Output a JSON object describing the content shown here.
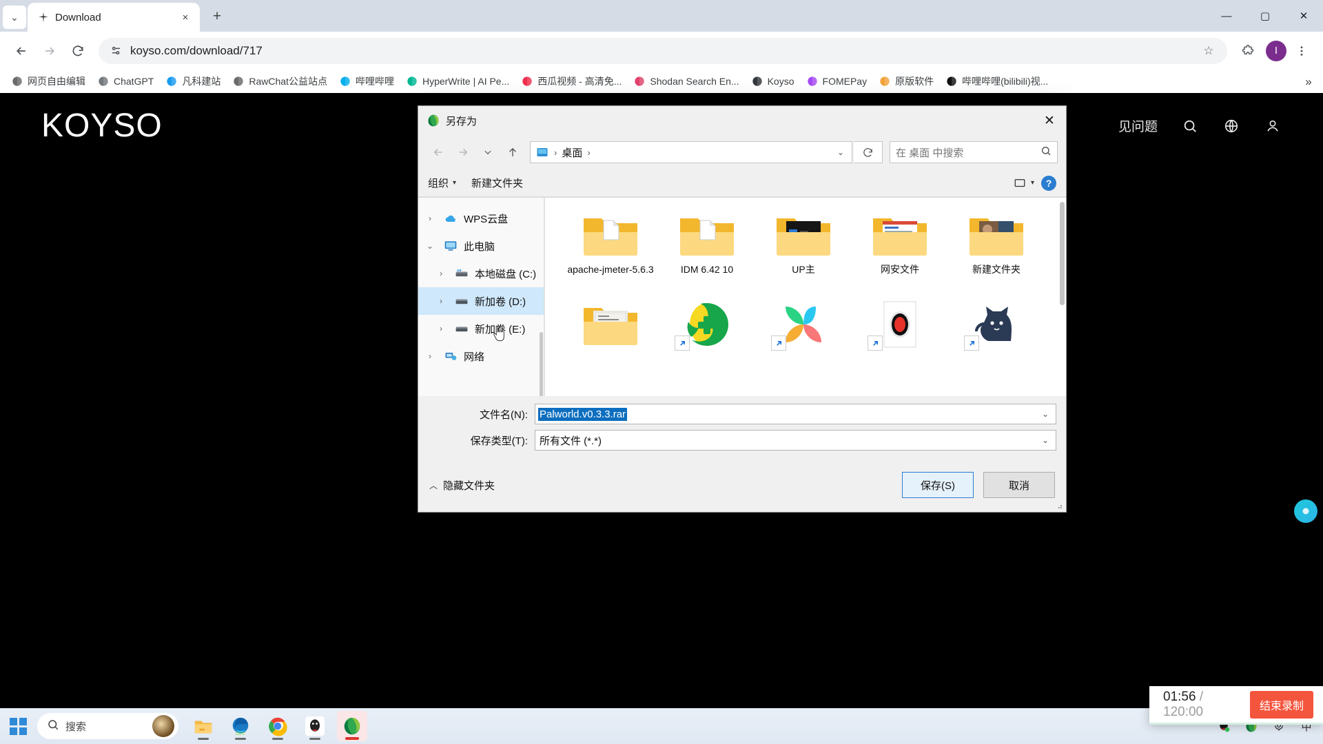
{
  "browser": {
    "tab": {
      "title": "Download",
      "favicon": "sparkle-icon",
      "close": "×"
    },
    "newtab_label": "+",
    "tablist_caret": "⌄",
    "window_controls": {
      "minimize": "—",
      "maximize": "▢",
      "close": "✕"
    },
    "toolbar": {
      "back": "←",
      "forward": "→",
      "reload": "⟳",
      "url": "koyso.com/download/717",
      "site_info_icon": "page-info-icon",
      "bookmark_star": "☆",
      "extensions": "puzzle-icon",
      "profile_initial": "I",
      "menu": "⋮"
    },
    "bookmarks": [
      {
        "label": "网页自由编辑",
        "icon": "globe-icon",
        "color": "#6a6a6a"
      },
      {
        "label": "ChatGPT",
        "icon": "openai-icon",
        "color": "#74797e"
      },
      {
        "label": "凡科建站",
        "icon": "fanke-icon",
        "color": "#1a9cf0"
      },
      {
        "label": "RawChat公益站点",
        "icon": "globe-icon",
        "color": "#6a6a6a"
      },
      {
        "label": "哔哩哔哩",
        "icon": "bilibili-icon",
        "color": "#00aeec"
      },
      {
        "label": "HyperWrite | AI Pe...",
        "icon": "hyperwrite-icon",
        "color": "#00b894"
      },
      {
        "label": "西瓜视频 - 高清免...",
        "icon": "xigua-icon",
        "color": "#ef2e4d"
      },
      {
        "label": "Shodan Search En...",
        "icon": "shodan-icon",
        "color": "#e0416a"
      },
      {
        "label": "Koyso",
        "icon": "sparkle-icon",
        "color": "#33373b"
      },
      {
        "label": "FOMEPay",
        "icon": "fomepay-icon",
        "color": "#a64bf4"
      },
      {
        "label": "原版软件",
        "icon": "yuanban-icon",
        "color": "#f2a33c"
      },
      {
        "label": "哔哩哔哩(bilibili)视...",
        "icon": "bilibili-dark-icon",
        "color": "#111111"
      }
    ],
    "bookmarks_overflow": "»"
  },
  "site": {
    "logo": "KOYSO",
    "nav_partial": "见问题",
    "icons": [
      "search-icon",
      "globe-icon",
      "user-icon"
    ]
  },
  "dialog": {
    "title": "另存为",
    "title_icon": "idm-icon",
    "close": "✕",
    "nav": {
      "back": "←",
      "forward": "→",
      "recent": "⌄",
      "up": "↑",
      "history_caret": "⌄",
      "refresh": "⟳"
    },
    "address": {
      "icon": "desktop-folder-icon",
      "crumb": "桌面",
      "sep": "›"
    },
    "search": {
      "placeholder": "在 桌面 中搜索",
      "icon": "search-icon"
    },
    "commands": {
      "organize": "组织",
      "organize_caret": "▾",
      "new_folder": "新建文件夹",
      "view_icon": "view-layout-icon",
      "view_caret": "▾",
      "help": "?"
    },
    "tree": [
      {
        "label": "WPS云盘",
        "icon": "cloud-icon",
        "chevron": "›",
        "indent": 0,
        "selected": false
      },
      {
        "label": "此电脑",
        "icon": "computer-icon",
        "chevron": "⌄",
        "indent": 0,
        "selected": false
      },
      {
        "label": "本地磁盘 (C:)",
        "icon": "os-drive-icon",
        "chevron": "›",
        "indent": 1,
        "selected": false
      },
      {
        "label": "新加卷 (D:)",
        "icon": "drive-icon",
        "chevron": "›",
        "indent": 1,
        "selected": true
      },
      {
        "label": "新加卷 (E:)",
        "icon": "drive-icon",
        "chevron": "›",
        "indent": 1,
        "selected": false
      },
      {
        "label": "网络",
        "icon": "network-icon",
        "chevron": "›",
        "indent": 0,
        "selected": false
      }
    ],
    "files": [
      {
        "label": "apache-jmeter-5.6.3",
        "type": "folder-doc",
        "shortcut": false
      },
      {
        "label": "IDM 6.42 10",
        "type": "folder-doc",
        "shortcut": false
      },
      {
        "label": "UP主",
        "type": "folder-dark-preview",
        "shortcut": false
      },
      {
        "label": "网安文件",
        "type": "folder-web-preview",
        "shortcut": false
      },
      {
        "label": "新建文件夹",
        "type": "folder-photo-preview",
        "shortcut": false
      },
      {
        "label": "",
        "type": "folder-receipt-preview",
        "shortcut": false
      },
      {
        "label": "",
        "type": "app-green-plus",
        "shortcut": true
      },
      {
        "label": "",
        "type": "app-petal",
        "shortcut": true
      },
      {
        "label": "",
        "type": "app-record-dot",
        "shortcut": true
      },
      {
        "label": "",
        "type": "app-cat",
        "shortcut": true
      }
    ],
    "fields": {
      "filename_label": "文件名(N):",
      "filename_value": "Palworld.v0.3.3.rar",
      "filetype_label": "保存类型(T):",
      "filetype_value": "所有文件 (*.*)",
      "caret": "⌄"
    },
    "footer": {
      "hide_folders": "隐藏文件夹",
      "hide_caret": "︿",
      "save": "保存(S)",
      "cancel": "取消"
    }
  },
  "taskbar": {
    "search_placeholder": "搜索",
    "search_icon": "magnifier-icon",
    "apps": [
      {
        "name": "file-explorer-icon",
        "running": true
      },
      {
        "name": "edge-dev-icon",
        "running": true
      },
      {
        "name": "chrome-icon",
        "running": true
      },
      {
        "name": "qq-icon",
        "running": true
      },
      {
        "name": "idm-icon",
        "running": true,
        "active": true
      }
    ],
    "tray": [
      {
        "name": "qq-tray-icon"
      },
      {
        "name": "idm-tray-icon"
      },
      {
        "name": "microphone-icon"
      },
      {
        "name": "ime-icon",
        "label": "中"
      }
    ]
  },
  "recorder": {
    "elapsed": "01:56",
    "separator": "/",
    "total": "120:00",
    "stop_label": "结束录制",
    "stop_color": "#f4553d"
  }
}
